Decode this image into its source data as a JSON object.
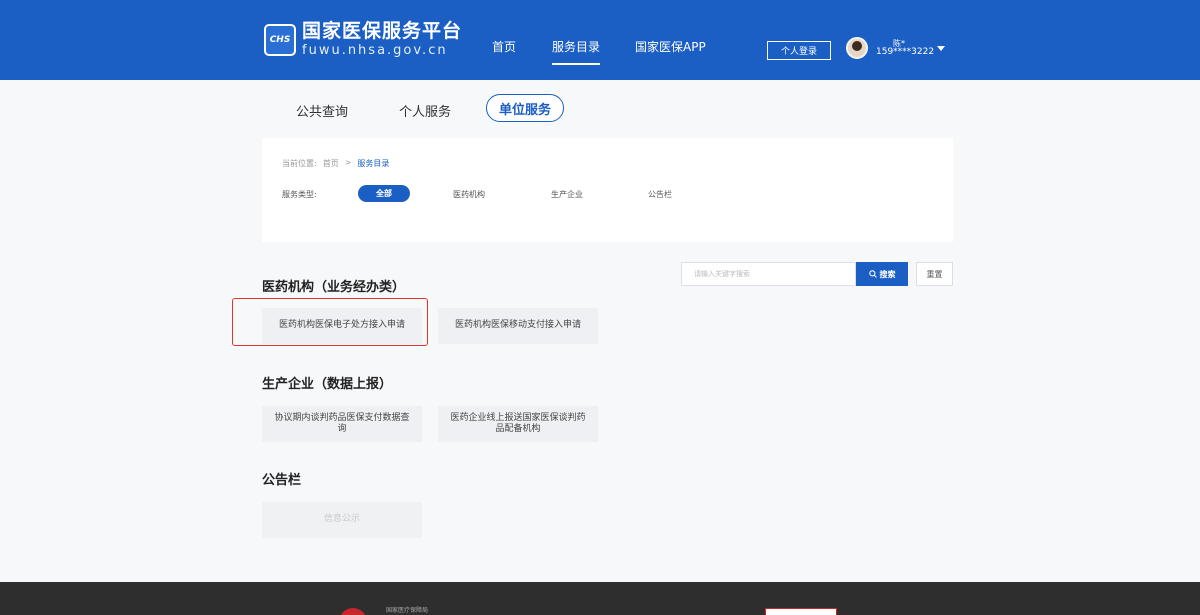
{
  "header": {
    "logo_badge": "CHS",
    "logo_title": "国家医保服务平台",
    "logo_url": "fuwu.nhsa.gov.cn",
    "nav": [
      {
        "label": "首页"
      },
      {
        "label": "服务目录"
      },
      {
        "label": "国家医保APP"
      }
    ],
    "login_label": "个人登录",
    "user_name": "陈*",
    "user_phone": "159****3222"
  },
  "tabs": [
    {
      "label": "公共查询"
    },
    {
      "label": "个人服务"
    },
    {
      "label": "单位服务"
    }
  ],
  "filter": {
    "breadcrumb_prefix": "当前位置:",
    "breadcrumb_home": "首页",
    "breadcrumb_sep": ">",
    "breadcrumb_current": "服务目录",
    "type_label": "服务类型:",
    "types": [
      {
        "label": "全部"
      },
      {
        "label": "医药机构"
      },
      {
        "label": "生产企业"
      },
      {
        "label": "公告栏"
      }
    ]
  },
  "search": {
    "placeholder": "请输入关键字搜索",
    "search_label": "搜索",
    "reset_label": "重置"
  },
  "sections": [
    {
      "title": "医药机构（业务经办类）",
      "items": [
        {
          "label": "医药机构医保电子处方接入申请"
        },
        {
          "label": "医药机构医保移动支付接入申请"
        }
      ]
    },
    {
      "title": "生产企业（数据上报）",
      "items": [
        {
          "label": "协议期内谈判药品医保支付数据查询"
        },
        {
          "label": "医药企业线上报送国家医保谈判药品配备机构"
        }
      ]
    },
    {
      "title": "公告栏",
      "items": [
        {
          "label": "信息公示"
        }
      ]
    }
  ],
  "footer": {
    "org_name": "国家医疗保障局"
  },
  "colors": {
    "brand": "#1b5fc4",
    "highlight": "#e5322d",
    "footer": "#2e2e2e"
  }
}
